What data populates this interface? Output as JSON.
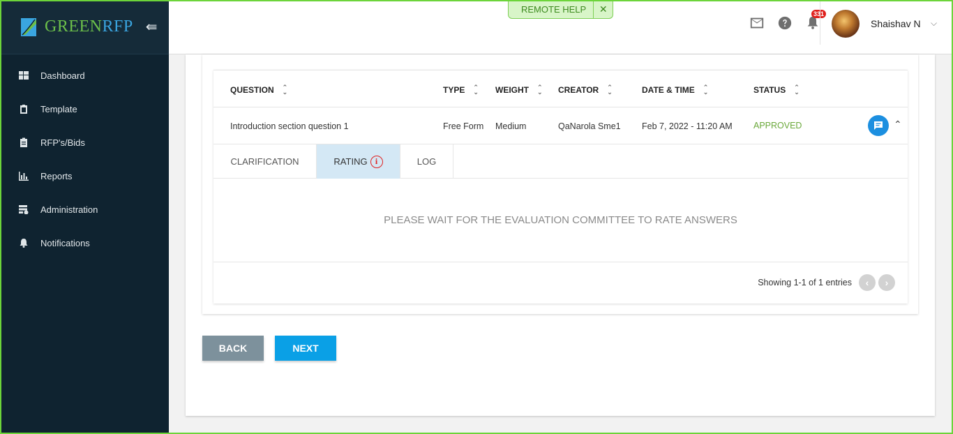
{
  "brand": {
    "name_part1": "GREEN",
    "name_part2": "RFP"
  },
  "sidebar": {
    "items": [
      {
        "label": "Dashboard",
        "icon": "dashboard-icon"
      },
      {
        "label": "Template",
        "icon": "template-icon"
      },
      {
        "label": "RFP's/Bids",
        "icon": "clipboard-icon"
      },
      {
        "label": "Reports",
        "icon": "bar-chart-icon"
      },
      {
        "label": "Administration",
        "icon": "admin-icon"
      },
      {
        "label": "Notifications",
        "icon": "bell-icon"
      }
    ]
  },
  "header": {
    "remote_help": "REMOTE HELP",
    "notification_count": "331",
    "user_name": "Shaishav N"
  },
  "table": {
    "columns": [
      "QUESTION",
      "TYPE",
      "WEIGHT",
      "CREATOR",
      "DATE & TIME",
      "STATUS"
    ],
    "row": {
      "question": "Introduction section question 1",
      "type": "Free Form",
      "weight": "Medium",
      "creator": "QaNarola Sme1",
      "datetime": "Feb 7, 2022 - 11:20 AM",
      "status": "APPROVED"
    },
    "tabs": [
      "CLARIFICATION",
      "RATING",
      "LOG"
    ],
    "active_tab": "RATING",
    "empty_message": "PLEASE WAIT FOR THE EVALUATION COMMITTEE TO RATE ANSWERS",
    "showing": "Showing 1-1 of 1 entries"
  },
  "buttons": {
    "back": "BACK",
    "next": "NEXT"
  },
  "colors": {
    "sidebar_bg": "#0f2330",
    "accent_blue": "#0aa0e6",
    "approved_green": "#6aa83a",
    "frame_green": "#6cd43a"
  }
}
